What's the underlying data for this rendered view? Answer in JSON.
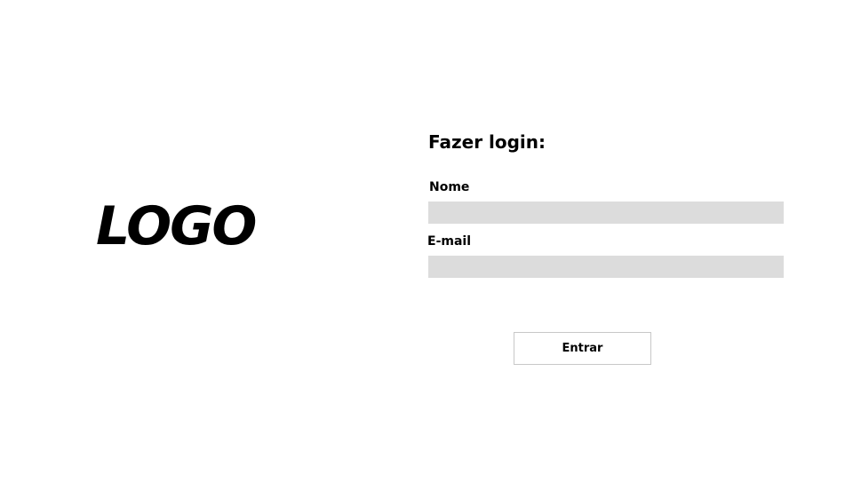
{
  "brand": {
    "logo_text": "LOGO"
  },
  "login": {
    "title": "Fazer login:",
    "fields": [
      {
        "label": "Nome",
        "value": "",
        "placeholder": ""
      },
      {
        "label": "E-mail",
        "value": "",
        "placeholder": ""
      }
    ],
    "submit_label": "Entrar"
  },
  "colors": {
    "background": "#ffffff",
    "input_background": "#dcdcdc",
    "button_border": "#c8c8c8",
    "text": "#000000"
  }
}
